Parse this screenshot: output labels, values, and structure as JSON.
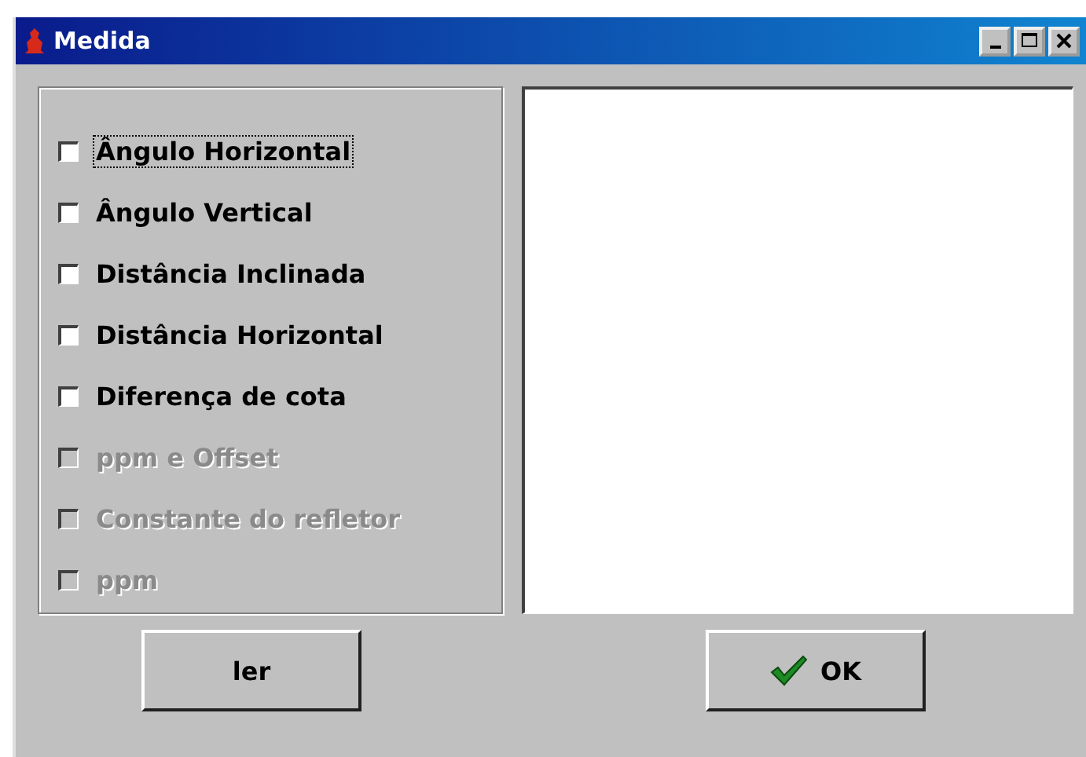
{
  "window": {
    "title": "Medida"
  },
  "options": [
    {
      "label": "Ângulo Horizontal",
      "checked": false,
      "disabled": false,
      "focused": true
    },
    {
      "label": "Ângulo Vertical",
      "checked": false,
      "disabled": false,
      "focused": false
    },
    {
      "label": "Distância Inclinada",
      "checked": false,
      "disabled": false,
      "focused": false
    },
    {
      "label": "Distância Horizontal",
      "checked": false,
      "disabled": false,
      "focused": false
    },
    {
      "label": "Diferença de cota",
      "checked": false,
      "disabled": false,
      "focused": false
    },
    {
      "label": "ppm e Offset",
      "checked": false,
      "disabled": true,
      "focused": false
    },
    {
      "label": "Constante do refletor",
      "checked": false,
      "disabled": true,
      "focused": false
    },
    {
      "label": "ppm",
      "checked": false,
      "disabled": true,
      "focused": false
    }
  ],
  "buttons": [
    {
      "label": "ler",
      "kind": "plain"
    },
    {
      "label": "OK",
      "kind": "ok"
    }
  ]
}
